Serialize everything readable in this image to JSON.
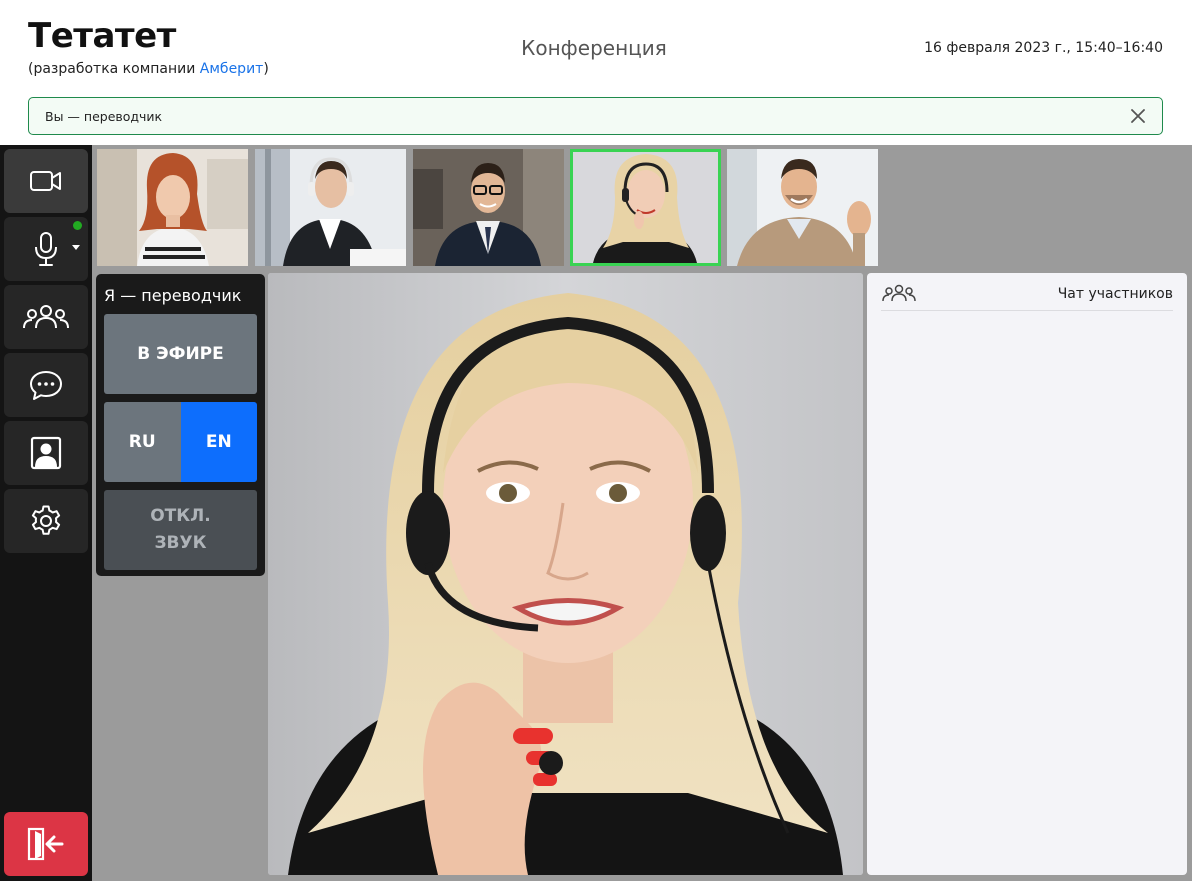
{
  "header": {
    "brand": "Тетатет",
    "subtitle_prefix": "(разработка компании ",
    "subtitle_link": "Амберит",
    "subtitle_suffix": ")",
    "title": "Конференция",
    "datetime": "16 февраля 2023 г., 15:40–16:40"
  },
  "alert": {
    "text": "Вы — переводчик"
  },
  "sidebar": {
    "items": [
      "video-camera-icon",
      "microphone-icon",
      "participants-icon",
      "chat-bubble-icon",
      "portrait-icon",
      "gear-icon"
    ],
    "exit": "exit-icon",
    "mic_status_color": "#22aa22"
  },
  "thumbnails": [
    {
      "person": "woman-red-hair"
    },
    {
      "person": "man-headphones-writing"
    },
    {
      "person": "man-glasses-suit"
    },
    {
      "person": "woman-blonde-headset",
      "selected": true
    },
    {
      "person": "man-waving"
    }
  ],
  "interpreter": {
    "title": "Я — переводчик",
    "on_air": "В ЭФИРЕ",
    "languages": [
      "RU",
      "EN"
    ],
    "active_language": "EN",
    "mute_line1": "ОТКЛ.",
    "mute_line2": "ЗВУК"
  },
  "chat": {
    "title": "Чат участников"
  },
  "colors": {
    "accent_blue": "#0d6efd",
    "exit_red": "#dc3545",
    "selected_green": "#39d353",
    "alert_border": "#1f8a4c"
  }
}
